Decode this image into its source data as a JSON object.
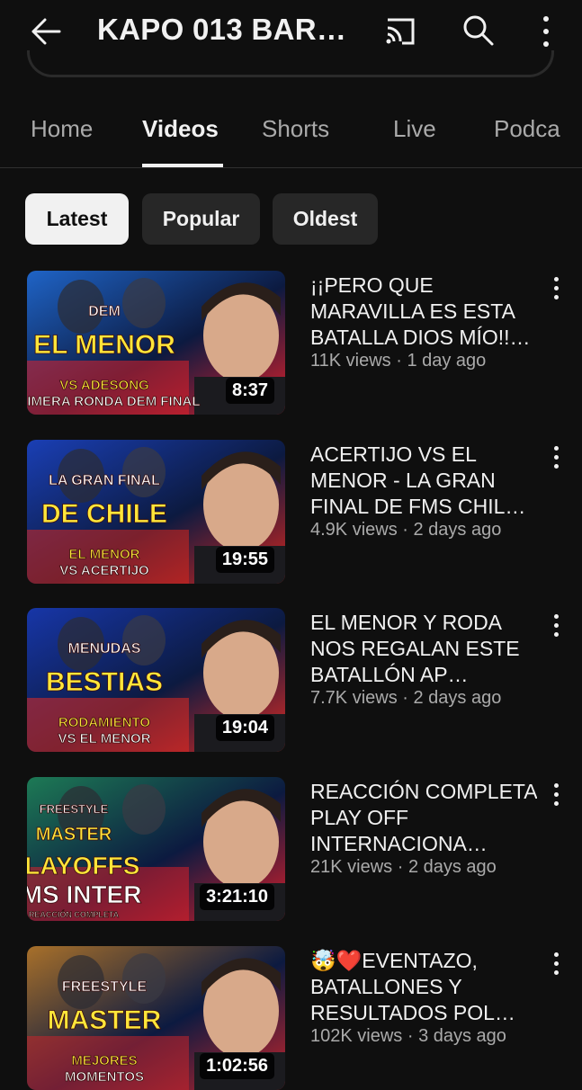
{
  "header": {
    "title": "KAPO 013 BAR…",
    "icons": [
      "back-arrow-icon",
      "cast-icon",
      "search-icon",
      "more-vert-icon"
    ]
  },
  "tabs": [
    {
      "label": "Home",
      "active": false
    },
    {
      "label": "Videos",
      "active": true
    },
    {
      "label": "Shorts",
      "active": false
    },
    {
      "label": "Live",
      "active": false
    },
    {
      "label": "Podca",
      "active": false
    }
  ],
  "chips": [
    {
      "label": "Latest",
      "selected": true
    },
    {
      "label": "Popular",
      "selected": false
    },
    {
      "label": "Oldest",
      "selected": false
    }
  ],
  "videos": [
    {
      "title": "¡¡PERO QUE MARAVILLA ES ESTA BATALLA DIOS MÍO!!…",
      "views": "11K views",
      "age": "1 day ago",
      "duration": "8:37",
      "thumb_text": [
        "DEM",
        "EL MENOR",
        "VS ADESONG",
        "PRIMERA RONDA DEM FINAL"
      ],
      "colors": [
        "#1f64c7",
        "#e0202a"
      ]
    },
    {
      "title": "ACERTIJO VS EL MENOR - LA GRAN FINAL DE FMS CHIL…",
      "views": "4.9K views",
      "age": "2 days ago",
      "duration": "19:55",
      "thumb_text": [
        "LA GRAN FINAL",
        "DE CHILE",
        "EL MENOR",
        "VS ACERTIJO"
      ],
      "colors": [
        "#1a3fb5",
        "#d7261e"
      ]
    },
    {
      "title": "EL MENOR Y RODA NOS REGALAN ESTE BATALLÓN AP…",
      "views": "7.7K views",
      "age": "2 days ago",
      "duration": "19:04",
      "thumb_text": [
        "MENUDAS",
        "BESTIAS",
        "RODAMIENTO",
        "VS EL MENOR"
      ],
      "colors": [
        "#1736a8",
        "#e12a22"
      ]
    },
    {
      "title": "REACCIÓN COMPLETA PLAY OFF INTERNACIONA…",
      "views": "21K views",
      "age": "2 days ago",
      "duration": "3:21:10",
      "thumb_text": [
        "FREESTYLE",
        "MASTER",
        "PLAYOFFS",
        "FMS INTER",
        "REACCIÓN COMPLETA"
      ],
      "colors": [
        "#1d7a55",
        "#d91f2a"
      ]
    },
    {
      "title": "🤯❤️EVENTAZO, BATALLONES Y RESULTADOS POL…",
      "views": "102K views",
      "age": "3 days ago",
      "duration": "1:02:56",
      "thumb_text": [
        "FREESTYLE",
        "MASTER",
        "MEJORES",
        "MOMENTOS"
      ],
      "colors": [
        "#a8702a",
        "#c8252b"
      ]
    }
  ]
}
